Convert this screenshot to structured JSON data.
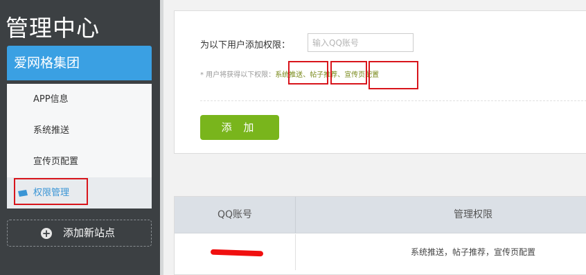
{
  "sidebar": {
    "title": "管理中心",
    "group": "爱网格集团",
    "items": [
      {
        "label": "APP信息"
      },
      {
        "label": "系统推送"
      },
      {
        "label": "宣传页配置"
      },
      {
        "label": "权限管理",
        "active": true
      }
    ],
    "add_site": "添加新站点"
  },
  "form": {
    "row_label": "为以下用户添加权限：",
    "input_placeholder": "输入QQ账号",
    "input_value": "",
    "perm_prefix": "* 用户将获得以下权限：",
    "permissions": [
      "系统推送",
      "帖子推荐",
      "宣传页配置"
    ],
    "separator": "、",
    "add_button": "添 加"
  },
  "table": {
    "headers": [
      "QQ账号",
      "管理权限"
    ],
    "rows": [
      {
        "qq": "",
        "permissions": "系统推送，帖子推荐，宣传页配置"
      }
    ]
  },
  "colors": {
    "sidebar_bg": "#3c4043",
    "accent_blue": "#3aa0e3",
    "add_button_green": "#79b51c",
    "highlight_red": "#d8141b",
    "permission_text": "#7a8a1c"
  },
  "icons": {
    "active_item": "flag-icon",
    "add_site": "plus-circle-icon"
  }
}
